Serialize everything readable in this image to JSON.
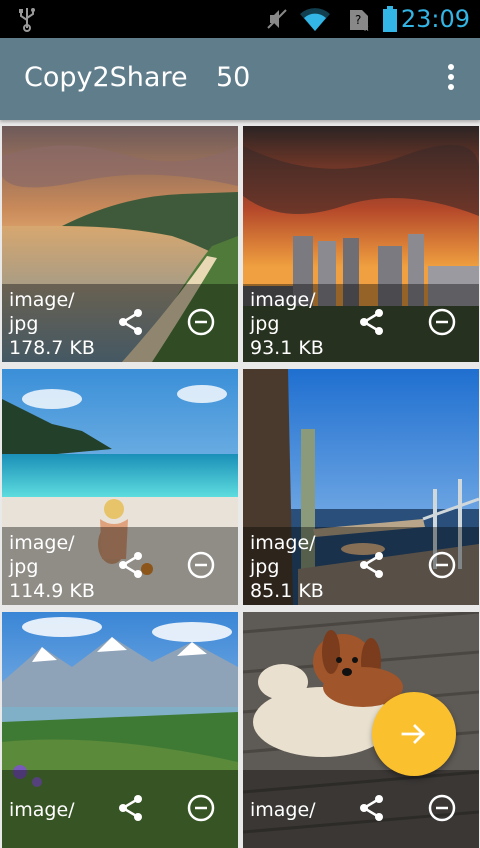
{
  "status_bar": {
    "time": "23:09",
    "icons": [
      "usb-icon",
      "mute-icon",
      "wifi-icon",
      "sim-icon",
      "battery-icon"
    ],
    "accent_color": "#33b5e5"
  },
  "app_bar": {
    "title": "Copy2Share",
    "count": "50",
    "menu_icon": "overflow-menu-icon",
    "color": "#607d8b"
  },
  "items": [
    {
      "mime": "image/\njpg",
      "size": "178.7 KB"
    },
    {
      "mime": "image/\njpg",
      "size": "93.1 KB"
    },
    {
      "mime": "image/\njpg",
      "size": "114.9 KB"
    },
    {
      "mime": "image/\njpg",
      "size": "85.1 KB"
    },
    {
      "mime": "image/",
      "size": ""
    },
    {
      "mime": "image/",
      "size": ""
    }
  ],
  "item_actions": {
    "share_icon": "share-icon",
    "remove_icon": "remove-circle-icon"
  },
  "fab": {
    "icon": "arrow-forward-icon",
    "color": "#fbc02d"
  }
}
